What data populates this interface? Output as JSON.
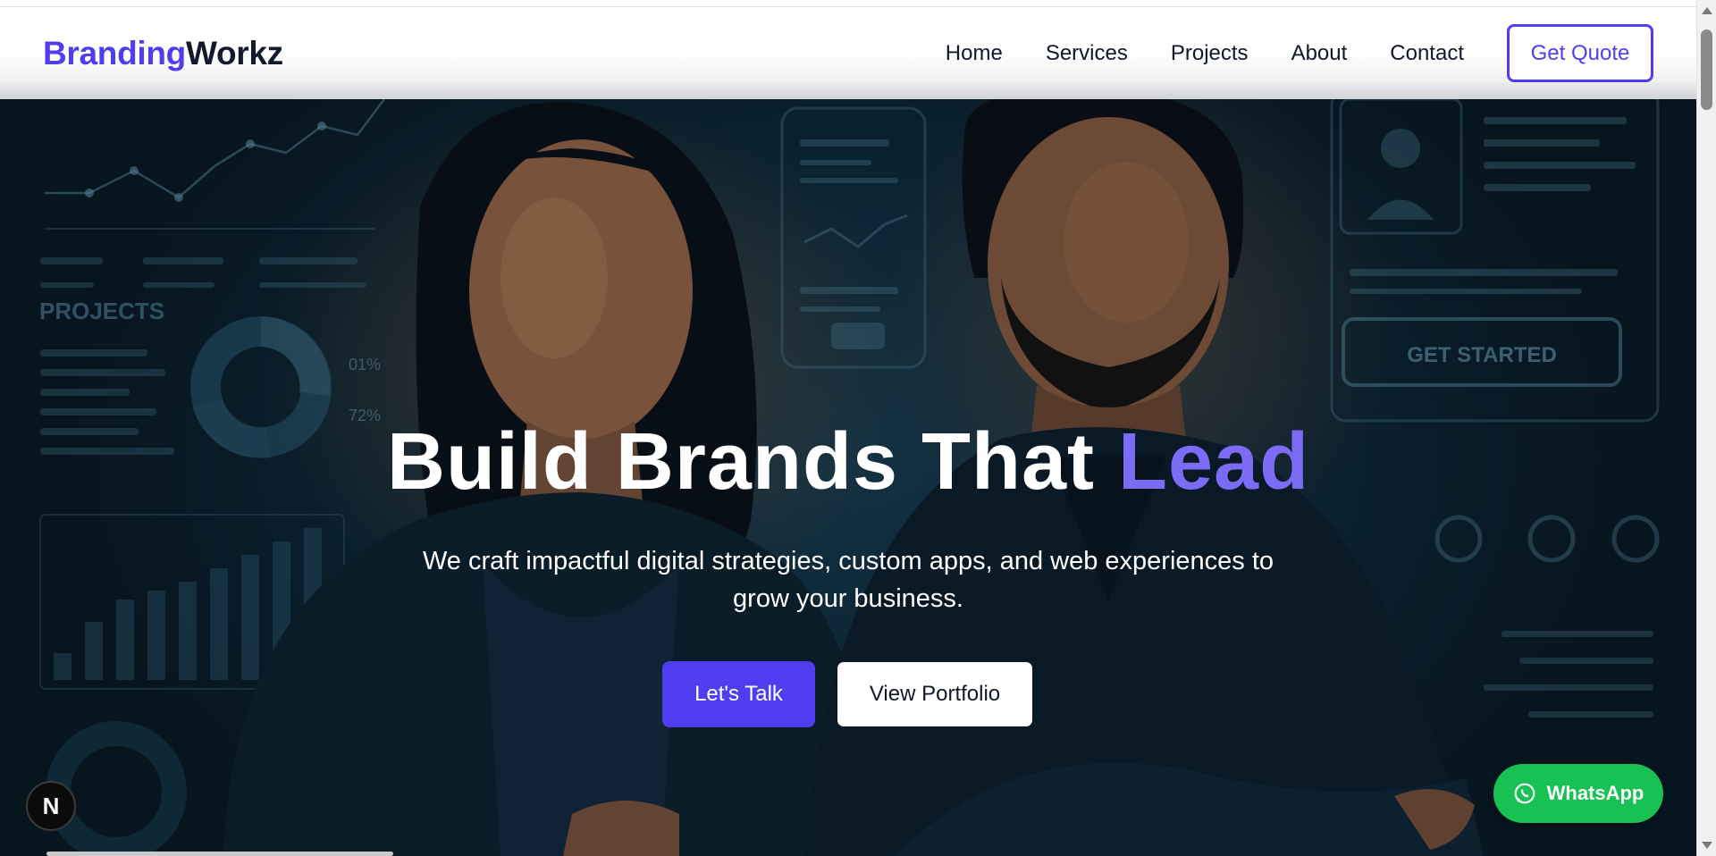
{
  "brand": {
    "part1": "Branding",
    "part2": "Workz"
  },
  "nav": {
    "links": [
      "Home",
      "Services",
      "Projects",
      "About",
      "Contact"
    ],
    "cta_label": "Get Quote"
  },
  "hero": {
    "title_main": "Build Brands That ",
    "title_accent": "Lead",
    "subtitle": "We craft impactful digital strategies, custom apps, and web experiences to grow your business.",
    "primary_button": "Let's Talk",
    "secondary_button": "View Portfolio",
    "background_texts": {
      "projects_label": "PROJECTS",
      "stat_1": "01%",
      "stat_2": "72%",
      "get_started": "GET STARTED"
    }
  },
  "floating": {
    "whatsapp_label": "WhatsApp",
    "n_badge": "N"
  },
  "colors": {
    "brand_primary": "#4f3ef0",
    "brand_dark": "#141a2e",
    "title_accent": "#7b6cf6",
    "whatsapp_green": "#17c152"
  },
  "icons": [
    "whatsapp-icon",
    "next-logo-icon",
    "scroll-up-icon",
    "scroll-down-icon"
  ]
}
